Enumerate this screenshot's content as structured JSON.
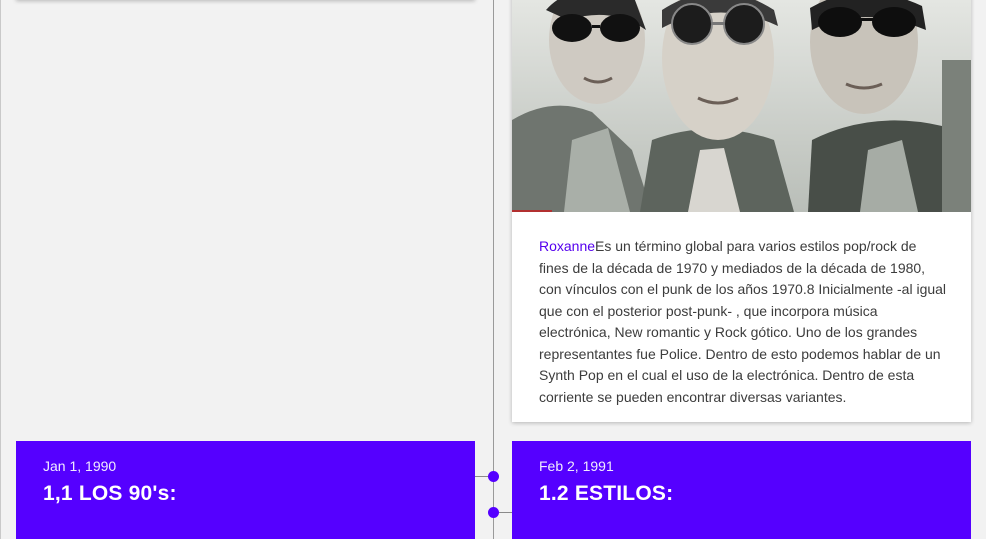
{
  "timeline": {
    "photo_card": {
      "image_alt": "Band photo of three men wearing sunglasses",
      "link_text": "Roxanne",
      "body": "Es un término global para varios estilos pop/rock de fines de la década de 1970 y mediados de la década de 1980, con vínculos con el punk de los años 1970.8 Inicialmente -al igual que con el posterior post-punk- , que incorpora música electrónica, New romantic y Rock gótico. Uno de los grandes representantes fue Police. Dentro de esto podemos hablar de un Synth Pop en el cual el uso de la electrónica. Dentro de esta corriente se pueden encontrar diversas variantes."
    },
    "events": [
      {
        "date": "Jan 1, 1990",
        "title": "1,1 LOS 90's:"
      },
      {
        "date": "Feb 2, 1991",
        "title": "1.2 ESTILOS:"
      }
    ]
  },
  "colors": {
    "accent": "#5500ff",
    "background": "#f2f2f2",
    "link": "#5500ee",
    "card": "#ffffff"
  }
}
